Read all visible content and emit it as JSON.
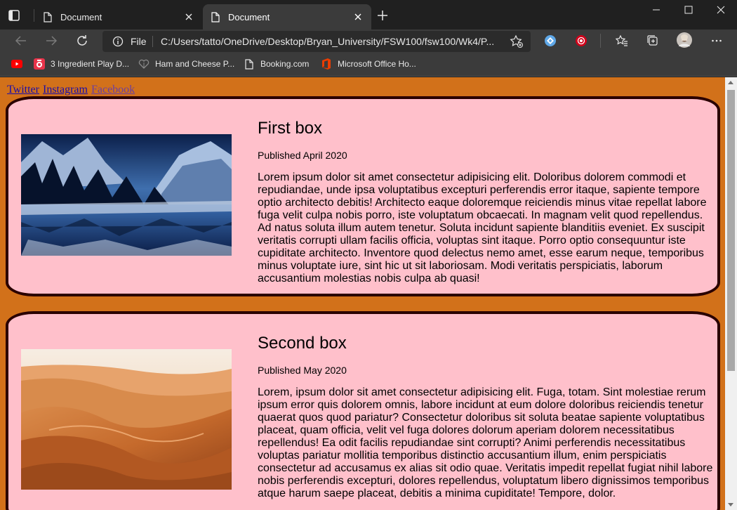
{
  "browser": {
    "tabs": [
      {
        "title": "Document",
        "active": false
      },
      {
        "title": "Document",
        "active": true
      }
    ],
    "address": {
      "scheme_label": "File",
      "url": "C:/Users/tatto/OneDrive/Desktop/Bryan_University/FSW100/fsw100/Wk4/P..."
    },
    "bookmarks": [
      {
        "label": "",
        "icon": "youtube-icon"
      },
      {
        "label": "3 Ingredient Play D...",
        "icon": "recipe-icon"
      },
      {
        "label": "Ham and Cheese P...",
        "icon": "heart-icon"
      },
      {
        "label": "Booking.com",
        "icon": "page-icon"
      },
      {
        "label": "Microsoft Office Ho...",
        "icon": "office-icon"
      }
    ]
  },
  "page": {
    "links": [
      "Twitter",
      "Instagram",
      "Facebook"
    ],
    "boxes": [
      {
        "title": "First box",
        "published": "Published April 2020",
        "image": "mountain-lake-image",
        "body": "Lorem ipsum dolor sit amet consectetur adipisicing elit. Doloribus dolorem commodi et repudiandae, unde ipsa voluptatibus excepturi perferendis error itaque, sapiente tempore optio architecto debitis! Architecto eaque doloremque reiciendis minus vitae repellat labore fuga velit culpa nobis porro, iste voluptatum obcaecati. In magnam velit quod repellendus. Ad natus soluta illum autem tenetur. Soluta incidunt sapiente blanditiis eveniet. Ex suscipit veritatis corrupti ullam facilis officia, voluptas sint itaque. Porro optio consequuntur iste cupiditate architecto. Inventore quod delectus nemo amet, esse earum neque, temporibus minus voluptate iure, sint hic ut sit laboriosam. Modi veritatis perspiciatis, laborum accusantium molestias nobis culpa ab quasi!"
      },
      {
        "title": "Second box",
        "published": "Published May 2020",
        "image": "desert-dunes-image",
        "body": "Lorem, ipsum dolor sit amet consectetur adipisicing elit. Fuga, totam. Sint molestiae rerum ipsum error quis dolorem omnis, labore incidunt at eum dolore doloribus reiciendis tenetur quaerat quos quod pariatur? Consectetur doloribus sit soluta beatae sapiente voluptatibus placeat, quam officia, velit vel fuga dolores dolorum aperiam dolorem necessitatibus repellendus! Ea odit facilis repudiandae sint corrupti? Animi perferendis necessitatibus voluptas pariatur mollitia temporibus distinctio accusantium illum, enim perspiciatis consectetur ad accusamus ex alias sit odio quae. Veritatis impedit repellat fugiat nihil labore nobis perferendis excepturi, dolores repellendus, voluptatum libero dignissimos temporibus atque harum saepe placeat, debitis a minima cupiditate! Tempore, dolor."
      }
    ]
  },
  "colors": {
    "page_background": "#d2711a",
    "box_background": "#ffc0cb",
    "box_border": "#2a0000",
    "link": "#1a0dab",
    "link_visited": "#6b3fa0"
  }
}
